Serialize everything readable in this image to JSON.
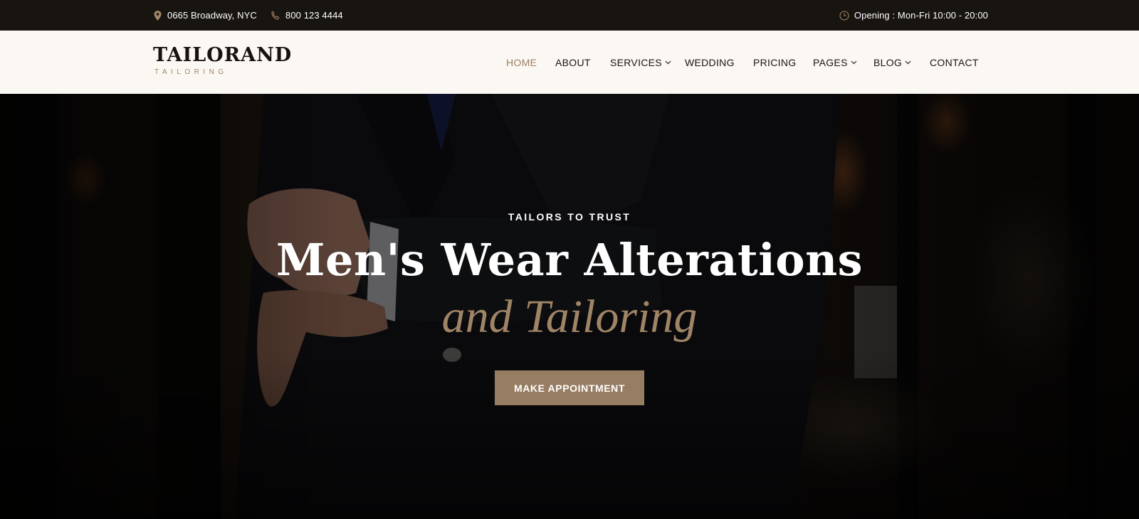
{
  "topbar": {
    "address": "0665 Broadway, NYC",
    "phone": "800 123 4444",
    "hours": "Opening : Mon-Fri 10:00 - 20:00",
    "icons": {
      "address": "map-pin-icon",
      "phone": "phone-icon",
      "hours": "clock-icon"
    }
  },
  "logo": {
    "name": "TAILORAND",
    "tagline": "TAILORING"
  },
  "nav": {
    "items": [
      {
        "label": "HOME",
        "active": true
      },
      {
        "label": "ABOUT"
      },
      {
        "label": "SERVICES",
        "dropdown": true
      },
      {
        "label": "WEDDING"
      },
      {
        "label": "PRICING"
      },
      {
        "label": "PAGES",
        "dropdown": true
      },
      {
        "label": "BLOG",
        "dropdown": true
      },
      {
        "label": "CONTACT"
      }
    ]
  },
  "hero": {
    "eyebrow": "TAILORS TO TRUST",
    "title_line1": "Men's Wear Alterations",
    "title_line2": "and Tailoring",
    "cta_label": "MAKE APPOINTMENT"
  },
  "colors": {
    "accent": "#977d62",
    "accent_text": "#a08466",
    "topbar_bg": "#181410",
    "header_bg": "#fbf8f3",
    "text_dark": "#161210"
  }
}
